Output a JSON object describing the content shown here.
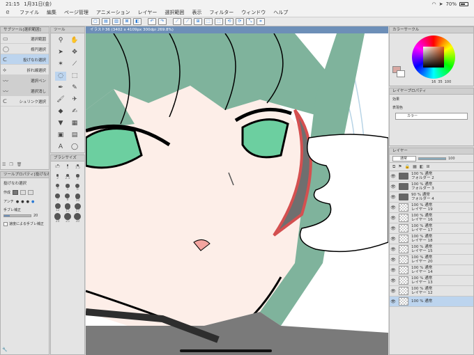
{
  "status": {
    "time": "21:15",
    "date": "1月31日(金)",
    "battery": "70%",
    "battery_fraction": 0.7
  },
  "menu": {
    "items": [
      "ファイル",
      "編集",
      "ページ管理",
      "アニメーション",
      "レイヤー",
      "選択範囲",
      "表示",
      "フィルター",
      "ウィンドウ",
      "ヘルプ"
    ]
  },
  "subtool": {
    "title": "サブツール[選択範囲]",
    "items": [
      "選択範囲",
      "楕円選択",
      "投げなわ選択",
      "折れ線選択",
      "選択ペン",
      "選択消し",
      "シュリンク選択"
    ],
    "selected": 2
  },
  "tools": {
    "title": "ツール"
  },
  "brush_size": {
    "title": "ブラシサイズ",
    "labels": [
      "0.7",
      "1",
      "1.5",
      "2",
      "2.5",
      "3",
      "4",
      "5",
      "6",
      "7",
      "8",
      "10",
      "12",
      "15",
      "17",
      "20",
      "25",
      "30"
    ]
  },
  "tool_property": {
    "title": "ツールプロパティ[投げなわ選択]",
    "tool_name": "投げなわ選択",
    "rows": [
      {
        "label": "作成"
      },
      {
        "label": "アンチ"
      },
      {
        "label": "手ブレ補正",
        "value": "20"
      }
    ],
    "checkbox_label": "速度による手ブレ補正"
  },
  "canvas": {
    "tab_label": "イラスト36 (3402 x 4109px 300dpi 269.8%)"
  },
  "color_circle": {
    "title": "カラーサークル",
    "values": [
      "16",
      "35",
      "100"
    ],
    "accent": "#d8a8a2"
  },
  "layer_property": {
    "title": "レイヤープロパティ",
    "effect_label": "効果",
    "color_label": "表現色",
    "color_value": "カラー"
  },
  "layers": {
    "title": "レイヤー",
    "blend": "通常",
    "opacity": "100",
    "rows": [
      {
        "top": "100 % 通常",
        "name": "フォルダー 2",
        "folder": true
      },
      {
        "top": "100 % 通常",
        "name": "フォルダー 3",
        "folder": true
      },
      {
        "top": "90 % 通常",
        "name": "フォルダー 4",
        "folder": true
      },
      {
        "top": "100 % 通常",
        "name": "レイヤー 19",
        "folder": false
      },
      {
        "top": "100 % 通常",
        "name": "レイヤー 16",
        "folder": false
      },
      {
        "top": "100 % 通常",
        "name": "レイヤー 17",
        "folder": false
      },
      {
        "top": "100 % 通常",
        "name": "レイヤー 18",
        "folder": false
      },
      {
        "top": "100 % 通常",
        "name": "レイヤー 15",
        "folder": false
      },
      {
        "top": "100 % 通常",
        "name": "レイヤー 20",
        "folder": false
      },
      {
        "top": "100 % 通常",
        "name": "レイヤー 14",
        "folder": false
      },
      {
        "top": "100 % 通常",
        "name": "レイヤー 13",
        "folder": false
      },
      {
        "top": "100 % 通常",
        "name": "レイヤー 12",
        "folder": false
      },
      {
        "top": "100 % 通常",
        "name": "",
        "folder": false
      }
    ]
  }
}
